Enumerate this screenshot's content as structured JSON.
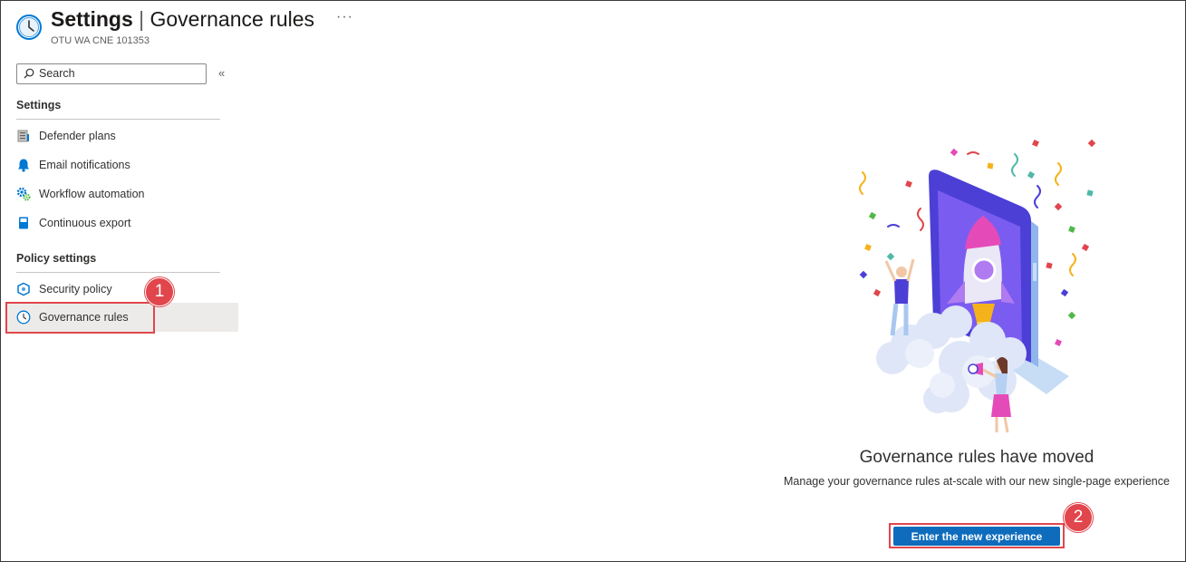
{
  "header": {
    "title_primary": "Settings",
    "title_separator": "|",
    "title_secondary": "Governance rules",
    "subtitle": "OTU WA CNE 101353",
    "more_label": "···",
    "icon": "clock-icon"
  },
  "sidebar": {
    "search_placeholder": "Search",
    "collapse_label": "«",
    "sections": [
      {
        "label": "Settings",
        "items": [
          {
            "label": "Defender plans",
            "icon": "defender-plans-icon"
          },
          {
            "label": "Email notifications",
            "icon": "bell-icon"
          },
          {
            "label": "Workflow automation",
            "icon": "gear-automation-icon"
          },
          {
            "label": "Continuous export",
            "icon": "export-book-icon"
          }
        ]
      },
      {
        "label": "Policy settings",
        "items": [
          {
            "label": "Security policy",
            "icon": "shield-policy-icon"
          },
          {
            "label": "Governance rules",
            "icon": "clock-icon",
            "active": true
          }
        ]
      }
    ]
  },
  "main": {
    "title": "Governance rules have moved",
    "description": "Manage your governance rules at-scale with our new single-page experience",
    "button_label": "Enter the new experience"
  },
  "callouts": [
    "1",
    "2"
  ],
  "colors": {
    "accent": "#0f6cbd",
    "callout": "#e0464c",
    "active_bg": "#edebe9"
  }
}
